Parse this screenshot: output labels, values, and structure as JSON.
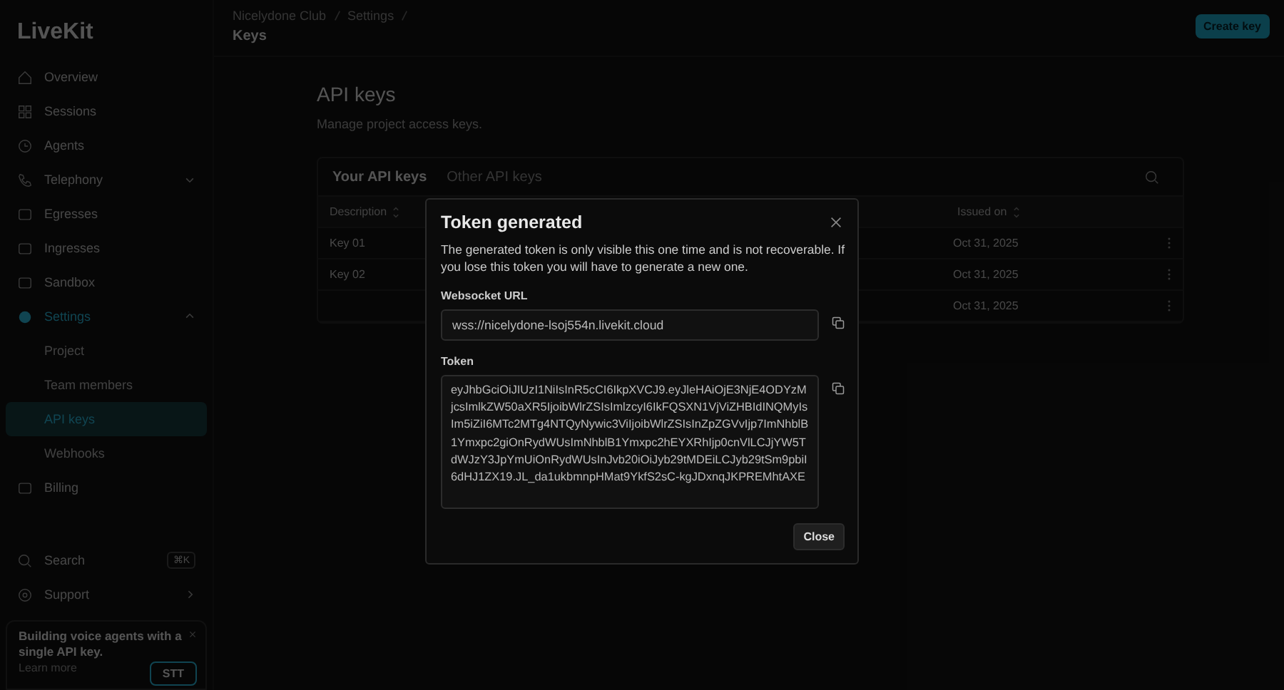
{
  "sidebar": {
    "logo": "LiveKit",
    "items": [
      {
        "label": "Overview",
        "selected": false
      },
      {
        "label": "Sessions",
        "selected": false
      },
      {
        "label": "Agents",
        "selected": false
      },
      {
        "label": "Telephony",
        "selected": false,
        "expanded": false
      },
      {
        "label": "Egresses",
        "selected": false
      },
      {
        "label": "Ingresses",
        "selected": false
      },
      {
        "label": "Sandbox",
        "selected": false
      },
      {
        "label": "Settings",
        "selected": true,
        "expanded": true,
        "children": [
          {
            "label": "Project",
            "selected": false
          },
          {
            "label": "Team members",
            "selected": false
          },
          {
            "label": "API keys",
            "selected": true
          },
          {
            "label": "Webhooks",
            "selected": false
          }
        ]
      },
      {
        "label": "Billing",
        "selected": false
      }
    ],
    "search": {
      "label": "Search",
      "shortcut": "⌘K"
    },
    "support": {
      "label": "Support"
    },
    "promo": {
      "text": "Building voice agents with a single API key.",
      "link": "Learn more",
      "badge": "STT"
    }
  },
  "header": {
    "breadcrumb": [
      "Nicelydone Club",
      "Settings"
    ],
    "title": "Keys",
    "button": "Create key"
  },
  "page": {
    "title": "API keys",
    "subtitle": "Manage project access keys.",
    "tabs": [
      {
        "label": "Your API keys",
        "selected": true
      },
      {
        "label": "Other API keys",
        "selected": false
      }
    ],
    "table": {
      "columns": [
        "Description",
        "Issued on"
      ],
      "rows": [
        {
          "description": "Key 01",
          "issued": "Oct 31, 2025"
        },
        {
          "description": "Key 02",
          "issued": "Oct 31, 2025"
        },
        {
          "issued": "Oct 31, 2025"
        }
      ]
    }
  },
  "dialog": {
    "title": "Token generated",
    "message": "The generated token is only visible this one time and is not recoverable. If you lose this token you will have to generate a new one.",
    "fields": [
      {
        "label": "Websocket URL",
        "value": "wss://nicelydone-lsoj554n.livekit.cloud"
      },
      {
        "label": "Token",
        "value": "eyJhbGciOiJIUzI1NiIsInR5cCI6IkpXVCJ9.eyJleHAiOjE3NjE4ODYzMjcsImlkZW50aXR5IjoibWlrZSIsImlzcyI6IkFQSXN1VjViZHBIdINQMyIsIm5iZiI6MTc2MTg4NTQyNywic3ViIjoibWlrZSIsInZpZGVvIjp7ImNhblB1Ymxpc2giOnRydWUsImNhblB1Ymxpc2hEYXRhIjp0cnVlLCJjYW5TdWJzY3JpYmUiOnRydWUsInJvb20iOiJyb29tMDEiLCJyb29tSm9pbiI6dHJ1ZX19.JL_da1ukbmnpHMat9YkfS2sC-kgJDxnqJKPREMhtAXE"
      }
    ],
    "button": "Close"
  }
}
